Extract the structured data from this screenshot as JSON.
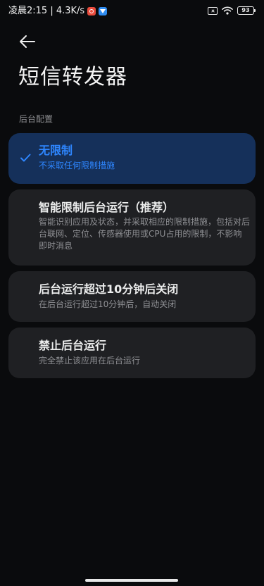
{
  "status_bar": {
    "time_and_speed": "凌晨2:15 | 4.3K/s",
    "battery": "93"
  },
  "header": {
    "title": "短信转发器"
  },
  "section": {
    "label": "后台配置"
  },
  "options": [
    {
      "title": "无限制",
      "desc": "不采取任何限制措施",
      "selected": true
    },
    {
      "title": "智能限制后台运行（推荐）",
      "desc": "智能识别应用及状态，并采取相应的限制措施，包括对后台联网、定位、传感器使用或CPU占用的限制，不影响即时消息",
      "selected": false
    },
    {
      "title": "后台运行超过10分钟后关闭",
      "desc": "在后台运行超过10分钟后，自动关闭",
      "selected": false
    },
    {
      "title": "禁止后台运行",
      "desc": "完全禁止该应用在后台运行",
      "selected": false
    }
  ],
  "colors": {
    "accent": "#2e86ff",
    "selected_card": "#15305a",
    "card": "#1f2023",
    "background": "#0a0b0d"
  },
  "icons": {
    "back": "arrow-left-icon",
    "check": "checkmark-icon"
  }
}
